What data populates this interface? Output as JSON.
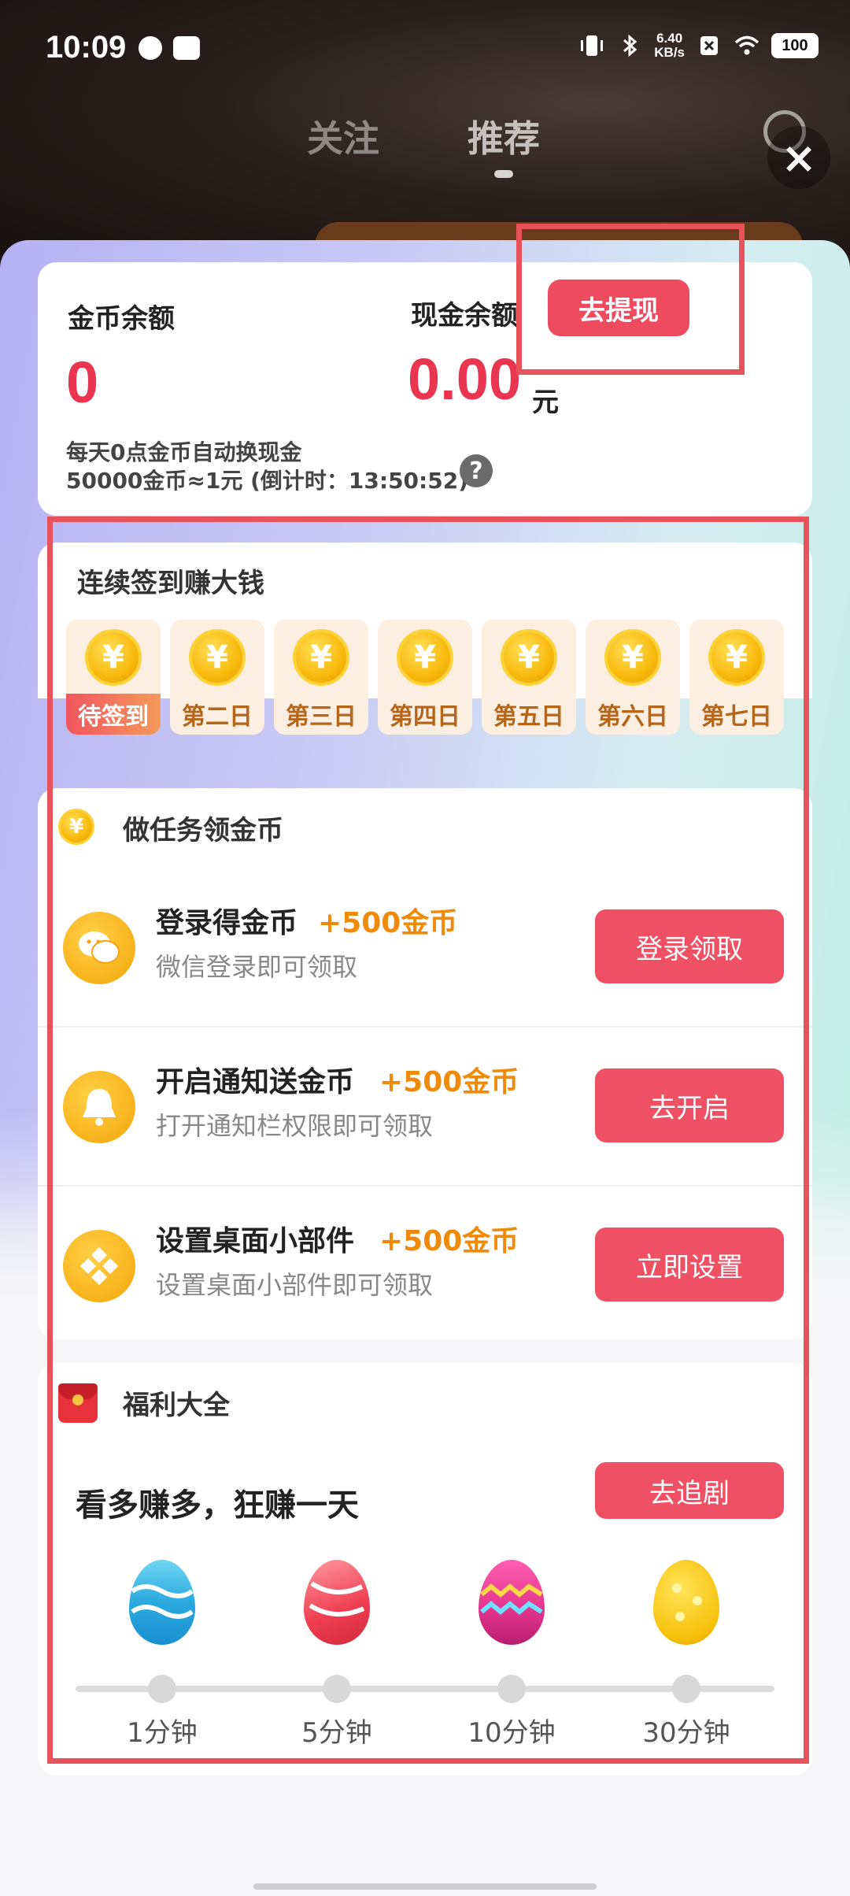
{
  "status_bar": {
    "time": "10:09",
    "net_speed_top": "6.40",
    "net_speed_bottom": "KB/s",
    "battery": "100"
  },
  "top_tabs": {
    "follow": "关注",
    "recommend": "推荐"
  },
  "balance": {
    "coin_label": "金币余额",
    "coin_value": "0",
    "cash_label": "现金余额",
    "cash_value": "0.00",
    "cash_unit": "元",
    "withdraw_label": "去提现",
    "note_line1": "每天0点金币自动换现金",
    "note_line2": "50000金币≈1元 (倒计时：13:50:52)"
  },
  "sign_in": {
    "title": "连续签到赚大钱",
    "days": [
      "待签到",
      "第二日",
      "第三日",
      "第四日",
      "第五日",
      "第六日",
      "第七日"
    ]
  },
  "tasks": {
    "title": "做任务领金币",
    "items": [
      {
        "title": "登录得金币",
        "reward": "+500金币",
        "sub": "微信登录即可领取",
        "button": "登录领取",
        "icon": "wechat-icon"
      },
      {
        "title": "开启通知送金币",
        "reward": "+500金币",
        "sub": "打开通知栏权限即可领取",
        "button": "去开启",
        "icon": "bell-icon"
      },
      {
        "title": "设置桌面小部件",
        "reward": "+500金币",
        "sub": "设置桌面小部件即可领取",
        "button": "立即设置",
        "icon": "widget-icon"
      }
    ]
  },
  "welfare": {
    "title": "福利大全",
    "headline": "看多赚多，狂赚一天",
    "button": "去追剧",
    "milestones": [
      "1分钟",
      "5分钟",
      "10分钟",
      "30分钟"
    ]
  },
  "colors": {
    "accent_red": "#ee4b5f",
    "reward_orange": "#f08a0a",
    "highlight_frame": "#e8525a"
  }
}
